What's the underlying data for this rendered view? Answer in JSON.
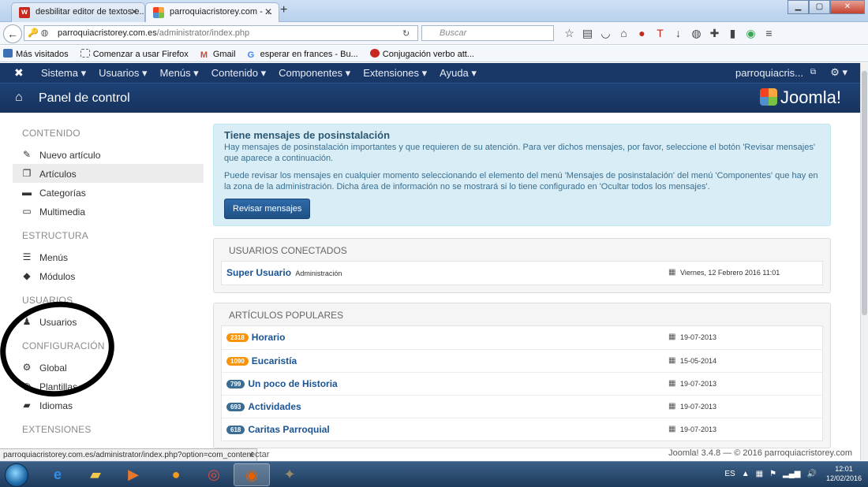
{
  "browser": {
    "tabs": [
      {
        "title": "desbilitar editor de textos e...",
        "favicon": "w"
      },
      {
        "title": "parroquiacristorey.com - ...",
        "favicon": "joomla"
      }
    ],
    "url_host": "parroquiacristorey.com.es",
    "url_path": "/administrator/index.php",
    "search_placeholder": "Buscar",
    "bookmarks": [
      "Más visitados",
      "Comenzar a usar Firefox",
      "Gmail",
      "esperar en frances - Bu...",
      "Conjugación verbo att..."
    ]
  },
  "joomla_nav": {
    "menu": [
      "Sistema ▾",
      "Usuarios ▾",
      "Menús ▾",
      "Contenido ▾",
      "Componentes ▾",
      "Extensiones ▾",
      "Ayuda ▾"
    ],
    "user": "parroquiacris...",
    "gear": "⚙ ▾"
  },
  "header": {
    "title": "Panel de control",
    "logo_text": "Joomla!"
  },
  "sidebar": {
    "sections": [
      {
        "title": "CONTENIDO",
        "items": [
          {
            "label": "Nuevo artículo",
            "icon": "pencil-icon",
            "glyph": "✎"
          },
          {
            "label": "Artículos",
            "icon": "stack-icon",
            "glyph": "❐"
          },
          {
            "label": "Categorías",
            "icon": "folder-icon",
            "glyph": "▬"
          },
          {
            "label": "Multimedia",
            "icon": "image-icon",
            "glyph": "▭"
          }
        ]
      },
      {
        "title": "ESTRUCTURA",
        "items": [
          {
            "label": "Menús",
            "icon": "list-icon",
            "glyph": "☰"
          },
          {
            "label": "Módulos",
            "icon": "cube-icon",
            "glyph": "◆"
          }
        ]
      },
      {
        "title": "USUARIOS",
        "items": [
          {
            "label": "Usuarios",
            "icon": "users-icon",
            "glyph": "👤"
          }
        ]
      },
      {
        "title": "CONFIGURACIÓN",
        "items": [
          {
            "label": "Global",
            "icon": "cog-icon",
            "glyph": "⚙"
          },
          {
            "label": "Plantillas",
            "icon": "eye-icon",
            "glyph": "◉"
          },
          {
            "label": "Idiomas",
            "icon": "comments-icon",
            "glyph": "▰"
          }
        ]
      },
      {
        "title": "EXTENSIONES",
        "items": []
      }
    ]
  },
  "alert": {
    "title": "Tiene mensajes de posinstalación",
    "p1": "Hay mensajes de posinstalación importantes y que requieren de su atención. Para ver dichos mensajes, por favor, seleccione el botón 'Revisar mensajes' que aparece a continuación.",
    "p2": "Puede revisar los mensajes en cualquier momento seleccionando el elemento del menú 'Mensajes de posinstalación' del menú 'Componentes' que hay en la zona de la administración. Dicha área de información no se mostrará si lo tiene configurado en 'Ocultar todos los mensajes'.",
    "button": "Revisar mensajes"
  },
  "logged_users": {
    "title": "USUARIOS CONECTADOS",
    "rows": [
      {
        "name": "Super Usuario",
        "role": "Administración",
        "date": "Viernes, 12 Febrero 2016 11:01"
      }
    ]
  },
  "popular_articles": {
    "title": "ARTÍCULOS POPULARES",
    "rows": [
      {
        "hits": "2318",
        "title": "Horario",
        "date": "19-07-2013",
        "color": "#f89406"
      },
      {
        "hits": "1090",
        "title": "Eucaristía",
        "date": "15-05-2014",
        "color": "#f89406"
      },
      {
        "hits": "799",
        "title": "Un poco de Historia",
        "date": "19-07-2013",
        "color": "#3a6d94"
      },
      {
        "hits": "693",
        "title": "Actividades",
        "date": "19-07-2013",
        "color": "#3a6d94"
      },
      {
        "hits": "618",
        "title": "Caritas Parroquial",
        "date": "19-07-2013",
        "color": "#3a6d94"
      }
    ]
  },
  "status": {
    "link_preview": "parroquiacristorey.com.es/administrator/index.php?option=com_content",
    "partial_text": "ectar",
    "footer": "Joomla! 3.4.8 — © 2016 parroquiacristorey.com"
  },
  "taskbar": {
    "lang": "ES",
    "time": "12:01",
    "date": "12/02/2016"
  },
  "colors": {
    "nav": "#1a3867",
    "link": "#1a5394",
    "alert_bg": "#d9edf7",
    "badge_orange": "#f89406",
    "badge_blue": "#3a6d94"
  }
}
